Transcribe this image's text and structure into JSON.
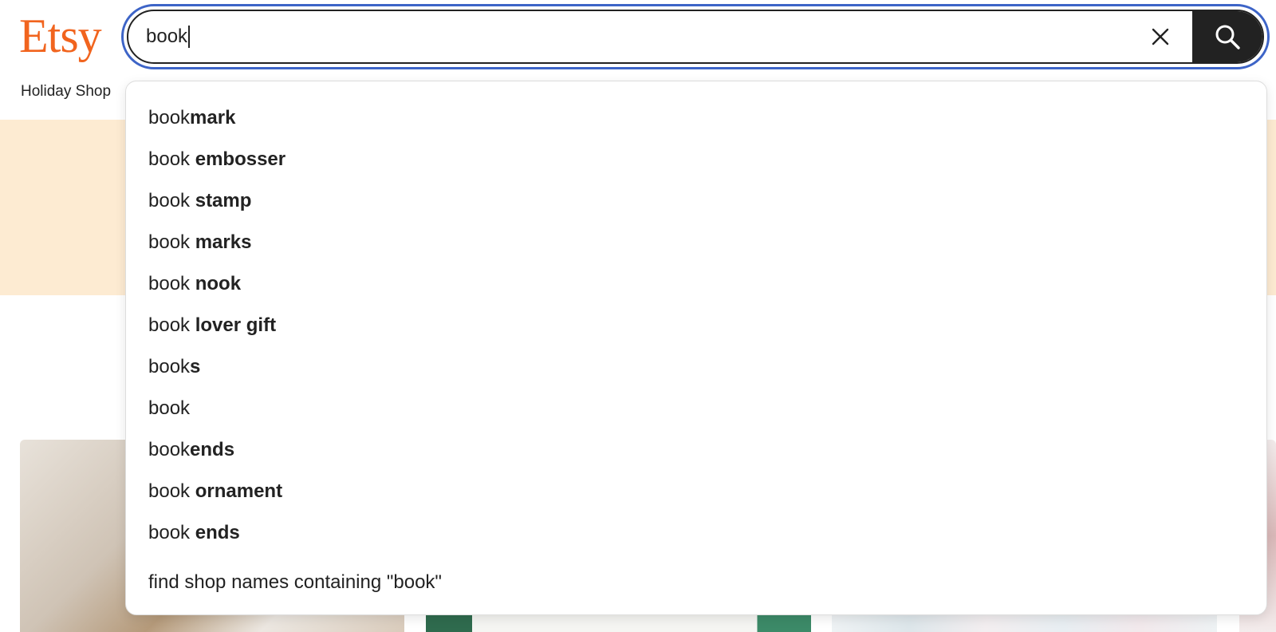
{
  "header": {
    "logo_text": "Etsy",
    "nav_items": [
      {
        "label": "Holiday Shop"
      }
    ]
  },
  "search": {
    "value": "book",
    "clear_icon": "close-icon",
    "submit_icon": "search-icon"
  },
  "suggestions": [
    {
      "typed": "book",
      "completion": "mark"
    },
    {
      "typed": "book ",
      "completion": "embosser"
    },
    {
      "typed": "book ",
      "completion": "stamp"
    },
    {
      "typed": "book ",
      "completion": "marks"
    },
    {
      "typed": "book ",
      "completion": "nook"
    },
    {
      "typed": "book ",
      "completion": "lover gift"
    },
    {
      "typed": "book",
      "completion": "s"
    },
    {
      "typed": "book",
      "completion": ""
    },
    {
      "typed": "book",
      "completion": "ends"
    },
    {
      "typed": "book ",
      "completion": "ornament"
    },
    {
      "typed": "book ",
      "completion": "ends"
    }
  ],
  "shop_names_suggestion": "find shop names containing \"book\"",
  "colors": {
    "brand": "#f1641e",
    "focus_ring": "#3d64c7",
    "search_button": "#222222",
    "promo_band": "#fdebd2"
  }
}
